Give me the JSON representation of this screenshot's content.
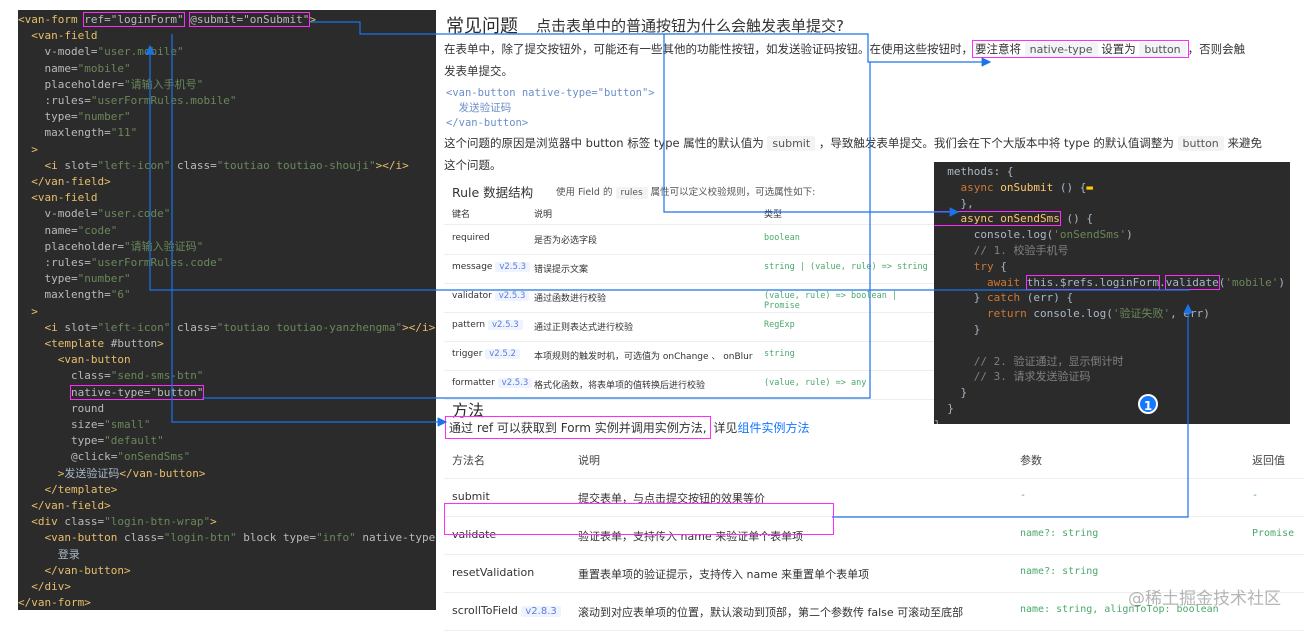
{
  "code_lines": [
    [
      [
        "t",
        "<van-form "
      ],
      [
        "box",
        "ref=\"loginForm\""
      ],
      [
        "p",
        " "
      ],
      [
        "box",
        "@submit=\"onSubmit\""
      ],
      [
        "t",
        ">"
      ]
    ],
    [
      [
        "t",
        "  <van-field"
      ]
    ],
    [
      [
        "a",
        "    v-model="
      ],
      [
        "s",
        "\"user.mobile\""
      ]
    ],
    [
      [
        "a",
        "    name="
      ],
      [
        "s",
        "\"mobile\""
      ]
    ],
    [
      [
        "a",
        "    placeholder="
      ],
      [
        "s",
        "\"请输入手机号\""
      ]
    ],
    [
      [
        "a",
        "    :rules="
      ],
      [
        "s",
        "\"userFormRules.mobile\""
      ]
    ],
    [
      [
        "a",
        "    type="
      ],
      [
        "s",
        "\"number\""
      ]
    ],
    [
      [
        "a",
        "    maxlength="
      ],
      [
        "s",
        "\"11\""
      ]
    ],
    [
      [
        "t",
        "  >"
      ]
    ],
    [
      [
        "t",
        "    <i "
      ],
      [
        "a",
        "slot="
      ],
      [
        "s",
        "\"left-icon\" "
      ],
      [
        "a",
        "class="
      ],
      [
        "s",
        "\"toutiao toutiao-shouji\""
      ],
      [
        "t",
        "></i>"
      ]
    ],
    [
      [
        "t",
        "  </van-field>"
      ]
    ],
    [
      [
        "t",
        "  <van-field"
      ]
    ],
    [
      [
        "a",
        "    v-model="
      ],
      [
        "s",
        "\"user.code\""
      ]
    ],
    [
      [
        "a",
        "    name="
      ],
      [
        "s",
        "\"code\""
      ]
    ],
    [
      [
        "a",
        "    placeholder="
      ],
      [
        "s",
        "\"请输入验证码\""
      ]
    ],
    [
      [
        "a",
        "    :rules="
      ],
      [
        "s",
        "\"userFormRules.code\""
      ]
    ],
    [
      [
        "a",
        "    type="
      ],
      [
        "s",
        "\"number\""
      ]
    ],
    [
      [
        "a",
        "    maxlength="
      ],
      [
        "s",
        "\"6\""
      ]
    ],
    [
      [
        "t",
        "  >"
      ]
    ],
    [
      [
        "t",
        "    <i "
      ],
      [
        "a",
        "slot="
      ],
      [
        "s",
        "\"left-icon\" "
      ],
      [
        "a",
        "class="
      ],
      [
        "s",
        "\"toutiao toutiao-yanzhengma\""
      ],
      [
        "t",
        "></i>"
      ]
    ],
    [
      [
        "t",
        "    <template "
      ],
      [
        "a",
        "#button"
      ],
      [
        "t",
        ">"
      ]
    ],
    [
      [
        "t",
        "      <van-button"
      ]
    ],
    [
      [
        "a",
        "        class="
      ],
      [
        "s",
        "\"send-sms-btn\""
      ]
    ],
    [
      [
        "p",
        "        "
      ],
      [
        "box",
        "native-type=\"button\""
      ]
    ],
    [
      [
        "a",
        "        round"
      ]
    ],
    [
      [
        "a",
        "        size="
      ],
      [
        "s",
        "\"small\""
      ]
    ],
    [
      [
        "a",
        "        type="
      ],
      [
        "s",
        "\"default\""
      ]
    ],
    [
      [
        "a",
        "        @click="
      ],
      [
        "s",
        "\"onSendSms\""
      ]
    ],
    [
      [
        "t",
        "      >"
      ],
      [
        "p",
        "发送验证码"
      ],
      [
        "t",
        "</van-button>"
      ]
    ],
    [
      [
        "t",
        "    </template>"
      ]
    ],
    [
      [
        "t",
        "  </van-field>"
      ]
    ],
    [
      [
        "t",
        "  <div "
      ],
      [
        "a",
        "class="
      ],
      [
        "s",
        "\"login-btn-wrap\""
      ],
      [
        "t",
        ">"
      ]
    ],
    [
      [
        "t",
        "    <van-button "
      ],
      [
        "a",
        "class="
      ],
      [
        "s",
        "\"login-btn\" "
      ],
      [
        "a",
        "block type="
      ],
      [
        "s",
        "\"info\" "
      ],
      [
        "a",
        "native-type"
      ]
    ],
    [
      [
        "p",
        "      登录"
      ]
    ],
    [
      [
        "t",
        "    </van-button>"
      ]
    ],
    [
      [
        "t",
        "  </div>"
      ]
    ],
    [
      [
        "t",
        "</van-form>"
      ]
    ]
  ],
  "faq": {
    "title": "常见问题",
    "question": "点击表单中的普通按钮为什么会触发表单提交?",
    "para1_a": "在表单中，除了提交按钮外，可能还有一些其他的功能性按钮，如发送验证码按钮。在使用这些按钮时，",
    "para1_b": "要注意将",
    "para1_chip1": "native-type",
    "para1_c": "设置为",
    "para1_chip2": "button",
    "para1_d": "，否则会触",
    "para1_e": "发表单提交。",
    "snippet": "<van-button native-type=\"button\">\n  发送验证码\n</van-button>",
    "para2_a": "这个问题的原因是浏览器中 button 标签 type 属性的默认值为",
    "para2_chip": "submit",
    "para2_b": "，导致触发表单提交。我们会在下个大版本中将 type 的默认值调整为",
    "para2_chip2": "button",
    "para2_c": "来避免",
    "para2_d": "这个问题。"
  },
  "rule": {
    "title": "Rule 数据结构",
    "desc_a": "使用 Field 的",
    "desc_chip": "rules",
    "desc_b": "属性可以定义校验规则，可选属性如下:",
    "headers": [
      "键名",
      "说明",
      "类型"
    ],
    "rows": [
      {
        "key": "required",
        "ver": "",
        "desc": "是否为必选字段",
        "type": "boolean"
      },
      {
        "key": "message",
        "ver": "v2.5.3",
        "desc": "错误提示文案",
        "type": "string | (value, rule) => string"
      },
      {
        "key": "validator",
        "ver": "v2.5.3",
        "desc": "通过函数进行校验",
        "type": "(value, rule) => boolean | Promise"
      },
      {
        "key": "pattern",
        "ver": "v2.5.3",
        "desc": "通过正则表达式进行校验",
        "type": "RegExp"
      },
      {
        "key": "trigger",
        "ver": "v2.5.2",
        "desc": "本项规则的触发时机，可选值为 onChange 、 onBlur",
        "type": "string"
      },
      {
        "key": "formatter",
        "ver": "v2.5.3",
        "desc": "格式化函数，将表单项的值转换后进行校验",
        "type": "(value, rule) => any"
      }
    ]
  },
  "methods_code": [
    [
      [
        "p",
        "  methods: {"
      ]
    ],
    [
      [
        "kw",
        "    async "
      ],
      [
        "fn",
        "onSubmit"
      ],
      [
        "p",
        " () {"
      ],
      [
        "yel",
        "▬"
      ]
    ],
    [
      [
        "p",
        "    },"
      ]
    ],
    [
      [
        "box2",
        "    async onSendSms"
      ],
      [
        "p",
        " () {"
      ]
    ],
    [
      [
        "p",
        "      console.log("
      ],
      [
        "str",
        "'onSendSms'"
      ],
      [
        "p",
        ")"
      ]
    ],
    [
      [
        "cm",
        "      // 1. 校验手机号"
      ]
    ],
    [
      [
        "kw",
        "      try "
      ],
      [
        "p",
        "{"
      ]
    ],
    [
      [
        "kw",
        "        await "
      ],
      [
        "box",
        "this.$refs.loginForm"
      ],
      [
        "p",
        "."
      ],
      [
        "box",
        "validate"
      ],
      [
        "p",
        "("
      ],
      [
        "str",
        "'mobile'"
      ],
      [
        "p",
        ")"
      ]
    ],
    [
      [
        "p",
        "      } "
      ],
      [
        "kw",
        "catch "
      ],
      [
        "p",
        "(err) {"
      ]
    ],
    [
      [
        "kw",
        "        return "
      ],
      [
        "p",
        "console.log("
      ],
      [
        "str",
        "'验证失败'"
      ],
      [
        "p",
        ", err)"
      ]
    ],
    [
      [
        "p",
        "      }"
      ]
    ],
    [
      [
        "p",
        ""
      ]
    ],
    [
      [
        "cm",
        "      // 2. 验证通过，显示倒计时"
      ]
    ],
    [
      [
        "cm",
        "      // 3. 请求发送验证码"
      ]
    ],
    [
      [
        "p",
        "    }"
      ]
    ],
    [
      [
        "p",
        "  }"
      ]
    ],
    [
      [
        "p",
        "}"
      ]
    ]
  ],
  "methods": {
    "title": "方法",
    "desc": "通过 ref 可以获取到 Form 实例并调用实例方法,",
    "desc_b": "详见",
    "link": "组件实例方法",
    "headers": [
      "方法名",
      "说明",
      "参数",
      "返回值"
    ],
    "rows": [
      {
        "name": "submit",
        "ver": "",
        "desc": "提交表单，与点击提交按钮的效果等价",
        "param": "-",
        "ret": "-"
      },
      {
        "name": "validate",
        "ver": "",
        "desc": "验证表单，支持传入 name 来验证单个表单项",
        "param": "name?: string",
        "ret": "Promise"
      },
      {
        "name": "resetValidation",
        "ver": "",
        "desc": "重置表单项的验证提示，支持传入 name 来重置单个表单项",
        "param": "name?: string",
        "ret": ""
      },
      {
        "name": "scrollToField",
        "ver": "v2.8.3",
        "desc": "滚动到对应表单项的位置，默认滚动到顶部，第二个参数传 false 可滚动至底部",
        "param": "name: string, alignToTop: boolean",
        "ret": ""
      }
    ]
  },
  "badge": "1",
  "watermark": "@稀土掘金技术社区",
  "colors": {
    "arrow": "#1a73e8",
    "highlight": "#ff2bff",
    "editor_bg": "#2b2b2b"
  }
}
